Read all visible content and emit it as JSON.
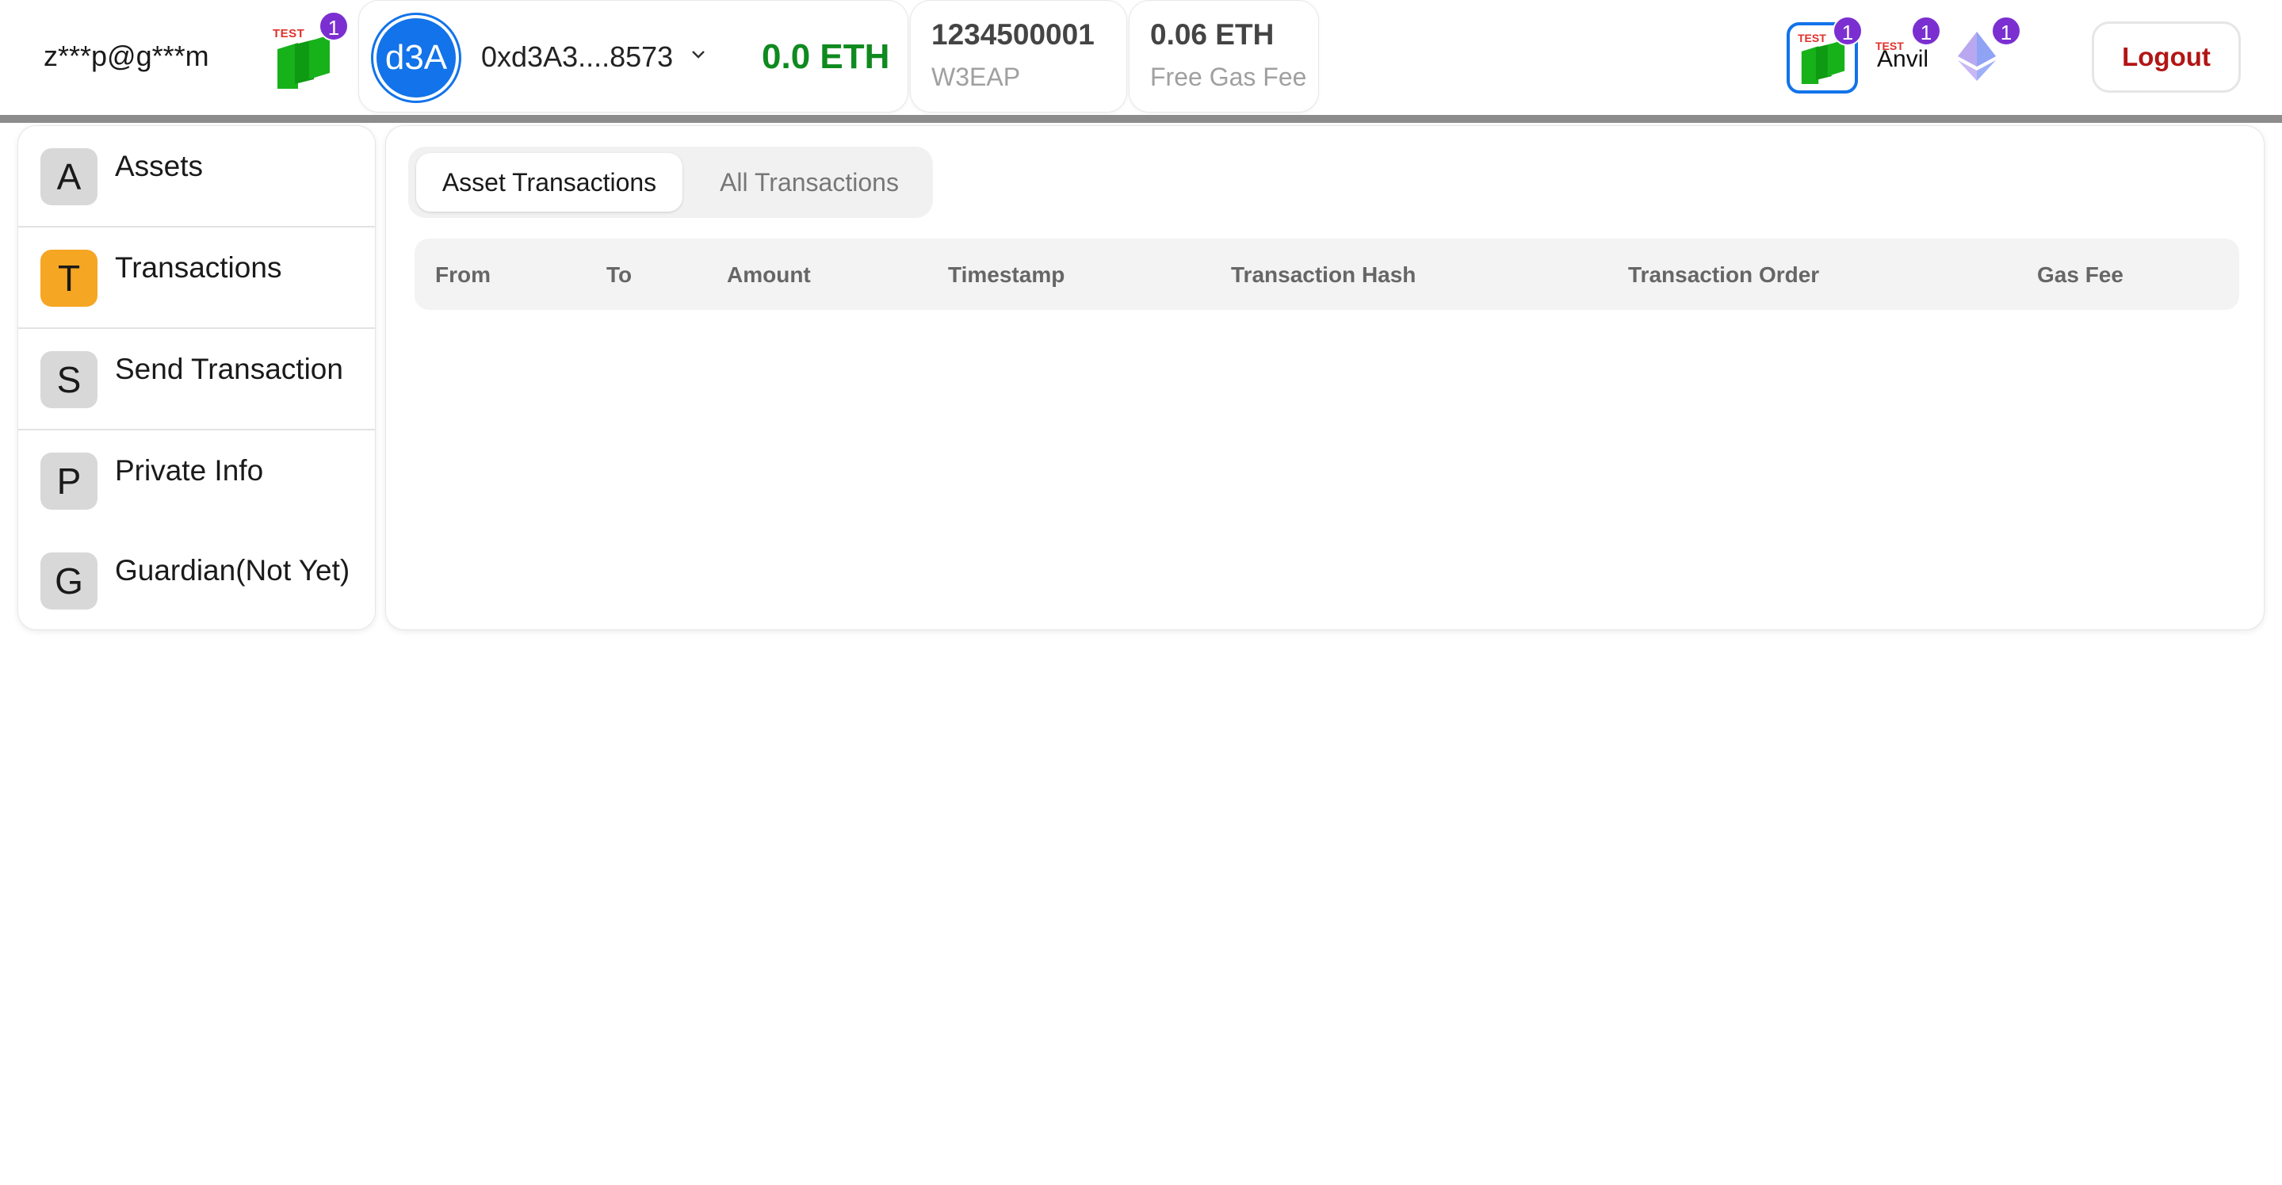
{
  "header": {
    "email": "z***p@g***m",
    "network_badge_count": "1",
    "network_logo_text": "TEST",
    "account": {
      "avatar_text": "d3A",
      "address": "0xd3A3....8573",
      "balance": "0.0 ETH"
    },
    "id_card": {
      "main": "1234500001",
      "sub": "W3EAP"
    },
    "gas_card": {
      "main": "0.06 ETH",
      "sub": "Free Gas Fee"
    },
    "networks": [
      {
        "name": "test-network",
        "badge": "1",
        "logo_text": "TEST"
      },
      {
        "name": "Anvil",
        "badge": "1",
        "logo_text": "TEST"
      },
      {
        "name": "ethereum",
        "badge": "1"
      }
    ],
    "logout_label": "Logout",
    "colors": {
      "accent": "#1273ea",
      "balance": "#0f8a1e",
      "badge": "#7b2fd1",
      "logout": "#b21515",
      "active_menu": "#f5a623"
    }
  },
  "sidebar": {
    "items": [
      {
        "letter": "A",
        "label": "Assets"
      },
      {
        "letter": "T",
        "label": "Transactions",
        "active": true
      },
      {
        "letter": "S",
        "label": "Send Transaction"
      },
      {
        "letter": "P",
        "label": "Private Info"
      },
      {
        "letter": "G",
        "label": "Guardian(Not Yet)"
      }
    ]
  },
  "main": {
    "tabs": [
      {
        "label": "Asset Transactions",
        "active": true
      },
      {
        "label": "All Transactions",
        "active": false
      }
    ],
    "table": {
      "columns": [
        "From",
        "To",
        "Amount",
        "Timestamp",
        "Transaction Hash",
        "Transaction Order",
        "Gas Fee"
      ],
      "rows": []
    }
  }
}
